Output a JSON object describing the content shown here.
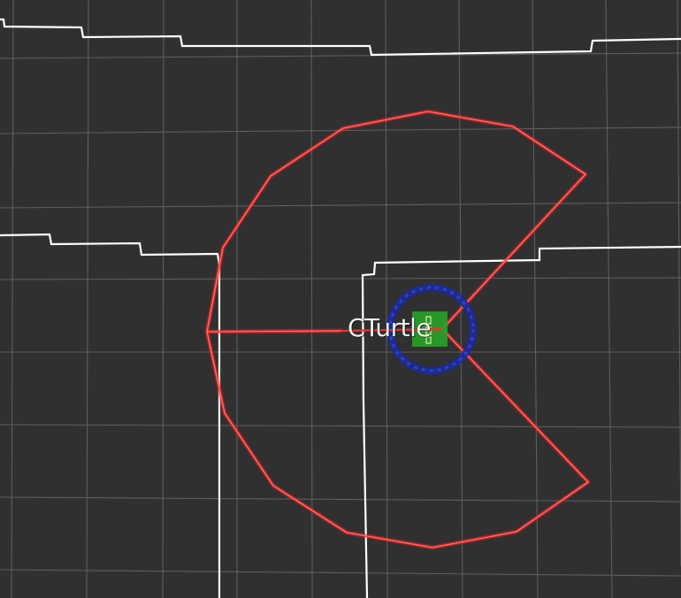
{
  "viewer": {
    "background_color": "#303030",
    "grid_color": "#5c5c5c",
    "wall_color": "#ffffff",
    "laser_color": "#ff2a2a",
    "robot_ring_color": "#1c2a9a",
    "robot_body_color": "#27a327"
  },
  "robot": {
    "label": "CTurtle"
  }
}
